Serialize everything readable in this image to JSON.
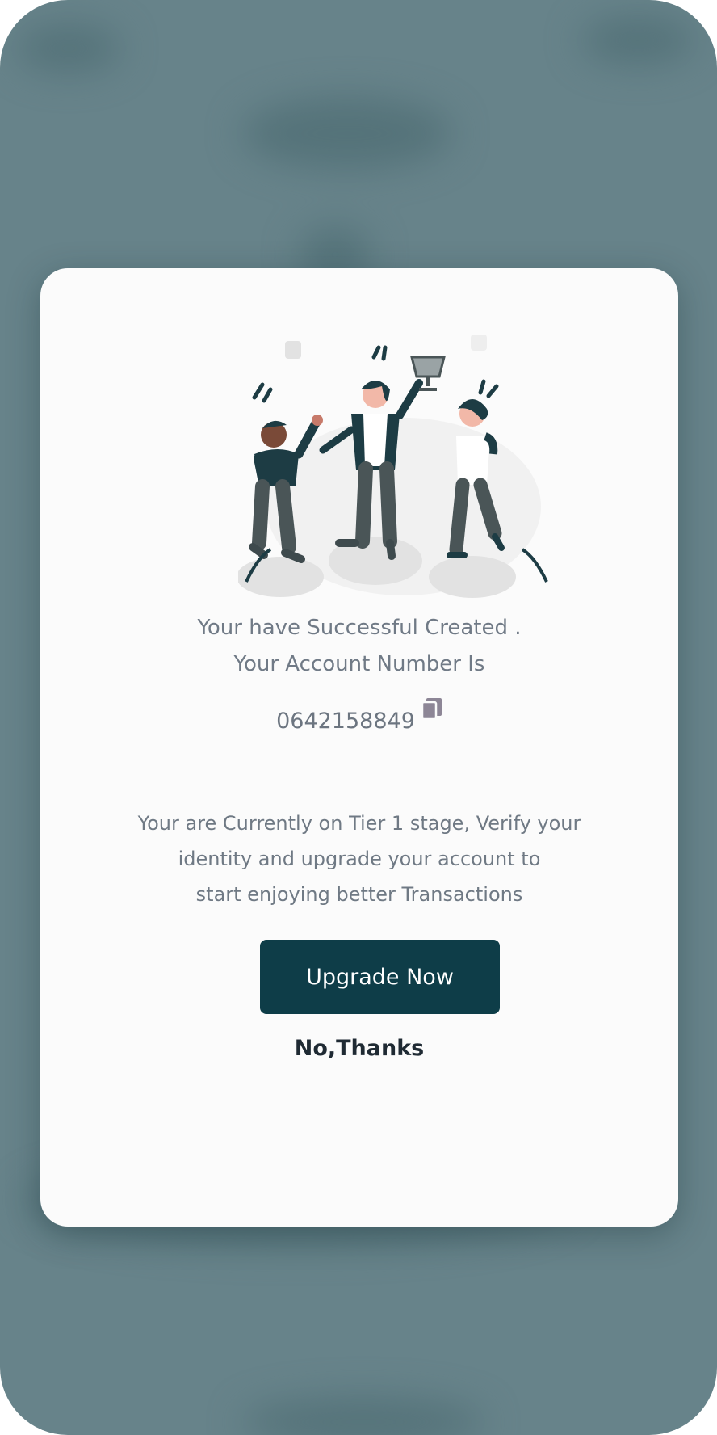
{
  "modal": {
    "message_line1": "Your have Successful Created .",
    "message_line2": "Your Account Number Is",
    "account_number": "0642158849",
    "tier_line1": "Your are Currently on Tier 1 stage, Verify your",
    "tier_line2": "identity and upgrade your account to",
    "tier_line3": "start enjoying better Transactions",
    "upgrade_label": "Upgrade Now",
    "decline_label": "No,Thanks"
  },
  "icons": {
    "copy": "copy-icon",
    "illustration": "celebration-illustration"
  },
  "colors": {
    "backdrop": "#67838a",
    "primary": "#0e3d48",
    "text": "#6f7984",
    "modal": "#fbfbfb"
  }
}
